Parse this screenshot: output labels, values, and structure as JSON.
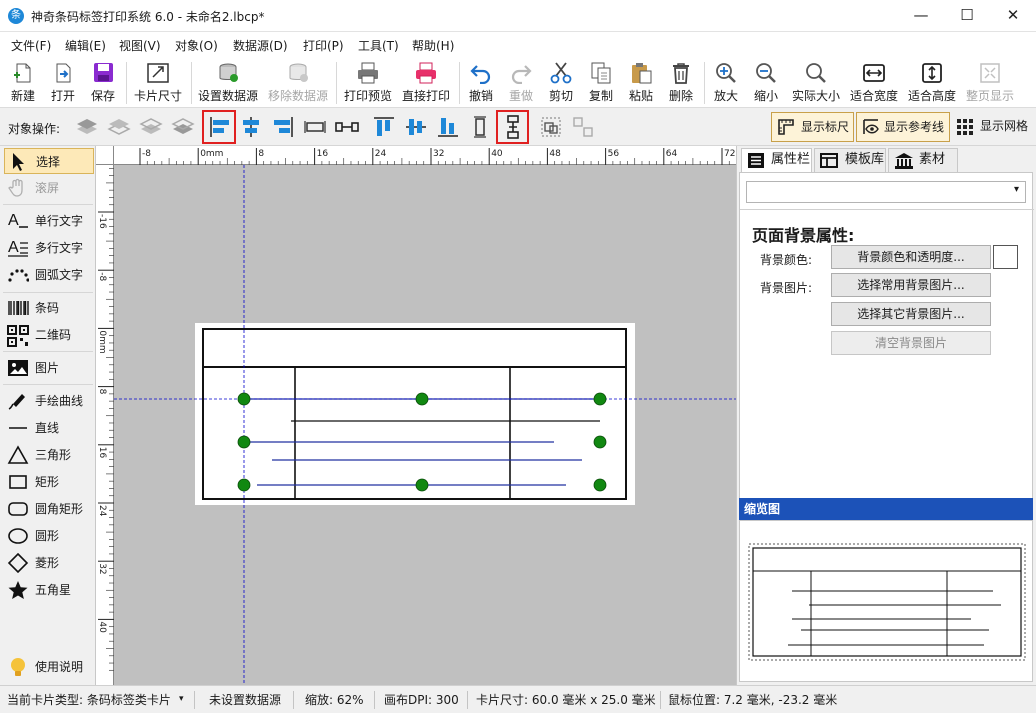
{
  "window": {
    "title": "神奇条码标签打印系统 6.0 - 未命名2.lbcp*",
    "app_icon": "条",
    "controls": [
      "—",
      "☐",
      "✕"
    ]
  },
  "menu": [
    "文件(F)",
    "编辑(E)",
    "视图(V)",
    "对象(O)",
    "数据源(D)",
    "打印(P)",
    "工具(T)",
    "帮助(H)"
  ],
  "toolbar": {
    "new": "新建",
    "open": "打开",
    "save": "保存",
    "card_size": "卡片尺寸",
    "set_datasource": "设置数据源",
    "remove_datasource": "移除数据源",
    "print_preview": "打印预览",
    "direct_print": "直接打印",
    "undo": "撤销",
    "redo": "重做",
    "cut": "剪切",
    "copy": "复制",
    "paste": "粘贴",
    "delete": "删除",
    "zoom_in": "放大",
    "zoom_out": "缩小",
    "actual_size": "实际大小",
    "fit_width": "适合宽度",
    "fit_height": "适合高度",
    "fit_page": "整页显示"
  },
  "objbar": {
    "label": "对象操作:",
    "show_ruler": "显示标尺",
    "show_guides": "显示参考线",
    "show_grid": "显示网格"
  },
  "tools": {
    "select": "选择",
    "scroll": "滚屏",
    "single_text": "单行文字",
    "multi_text": "多行文字",
    "arc_text": "圆弧文字",
    "barcode": "条码",
    "qrcode": "二维码",
    "image": "图片",
    "freehand": "手绘曲线",
    "line": "直线",
    "triangle": "三角形",
    "rect": "矩形",
    "round_rect": "圆角矩形",
    "ellipse": "圆形",
    "diamond": "菱形",
    "star": "五角星",
    "help": "使用说明"
  },
  "ruler": {
    "h_labels": [
      "-8",
      "0mm",
      "8",
      "16",
      "24",
      "32",
      "40",
      "48",
      "56",
      "64",
      "72"
    ],
    "v_labels": [
      "-16",
      "-8",
      "0mm",
      "8",
      "16",
      "24",
      "32",
      "40"
    ]
  },
  "panel": {
    "tabs": [
      "属性栏",
      "模板库",
      "素材库"
    ],
    "section_title": "页面背景属性:",
    "bg_color_label": "背景颜色:",
    "bg_color_btn": "背景颜色和透明度...",
    "bg_image_label": "背景图片:",
    "common_bg_btn": "选择常用背景图片...",
    "other_bg_btn": "选择其它背景图片...",
    "clear_bg_btn": "清空背景图片",
    "thumbnail_title": "缩览图"
  },
  "status": {
    "card_type": "当前卡片类型:  条码标签类卡片",
    "datasource": "未设置数据源",
    "zoom": "缩放:  62%",
    "dpi": "画布DPI:  300",
    "card_size": "卡片尺寸:  60.0 毫米 x 25.0 毫米",
    "mouse_pos": "鼠标位置:  7.2 毫米,  -23.2 毫米"
  },
  "colors": {
    "accent": "#1e88d8",
    "selection_handle": "#118811",
    "guide_line": "#0000cc",
    "highlight_box": "#e02020",
    "thumbnail_header": "#1c52b8"
  }
}
